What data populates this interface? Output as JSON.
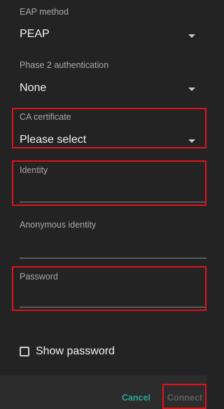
{
  "form": {
    "eap_method": {
      "label": "EAP method",
      "value": "PEAP",
      "icon": "chevron-down-icon"
    },
    "phase2": {
      "label": "Phase 2 authentication",
      "value": "None",
      "icon": "chevron-down-icon"
    },
    "ca_certificate": {
      "label": "CA certificate",
      "value": "Please select",
      "icon": "chevron-down-icon"
    },
    "identity": {
      "label": "Identity",
      "value": ""
    },
    "anonymous_identity": {
      "label": "Anonymous identity",
      "value": ""
    },
    "password": {
      "label": "Password",
      "value": ""
    },
    "show_password": {
      "label": "Show password",
      "checked": false,
      "icon": "checkbox-icon"
    }
  },
  "buttons": {
    "cancel": "Cancel",
    "connect": "Connect"
  },
  "colors": {
    "background": "#232323",
    "button_bar": "#2c2c2c",
    "accent": "#26a69a",
    "highlight": "#e0121b",
    "disabled": "#5e5e5e"
  }
}
